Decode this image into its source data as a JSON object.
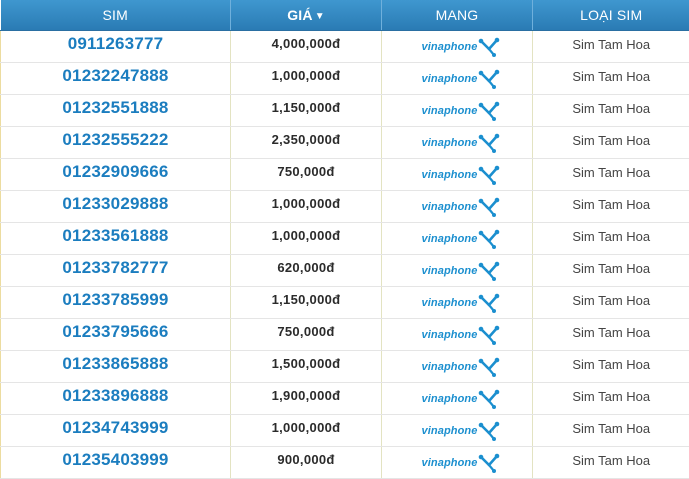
{
  "table": {
    "headers": {
      "sim": "SIM",
      "price": "GIÁ",
      "carrier": "MANG",
      "type": "LOẠI SIM"
    },
    "rows": [
      {
        "number": "0911263777",
        "price": "4,000,000đ",
        "carrier": "vinaphone",
        "type": "Sim Tam Hoa"
      },
      {
        "number": "01232247888",
        "price": "1,000,000đ",
        "carrier": "vinaphone",
        "type": "Sim Tam Hoa"
      },
      {
        "number": "01232551888",
        "price": "1,150,000đ",
        "carrier": "vinaphone",
        "type": "Sim Tam Hoa"
      },
      {
        "number": "01232555222",
        "price": "2,350,000đ",
        "carrier": "vinaphone",
        "type": "Sim Tam Hoa"
      },
      {
        "number": "01232909666",
        "price": "750,000đ",
        "carrier": "vinaphone",
        "type": "Sim Tam Hoa"
      },
      {
        "number": "01233029888",
        "price": "1,000,000đ",
        "carrier": "vinaphone",
        "type": "Sim Tam Hoa"
      },
      {
        "number": "01233561888",
        "price": "1,000,000đ",
        "carrier": "vinaphone",
        "type": "Sim Tam Hoa"
      },
      {
        "number": "01233782777",
        "price": "620,000đ",
        "carrier": "vinaphone",
        "type": "Sim Tam Hoa"
      },
      {
        "number": "01233785999",
        "price": "1,150,000đ",
        "carrier": "vinaphone",
        "type": "Sim Tam Hoa"
      },
      {
        "number": "01233795666",
        "price": "750,000đ",
        "carrier": "vinaphone",
        "type": "Sim Tam Hoa"
      },
      {
        "number": "01233865888",
        "price": "1,500,000đ",
        "carrier": "vinaphone",
        "type": "Sim Tam Hoa"
      },
      {
        "number": "01233896888",
        "price": "1,900,000đ",
        "carrier": "vinaphone",
        "type": "Sim Tam Hoa"
      },
      {
        "number": "01234743999",
        "price": "1,000,000đ",
        "carrier": "vinaphone",
        "type": "Sim Tam Hoa"
      },
      {
        "number": "01235403999",
        "price": "900,000đ",
        "carrier": "vinaphone",
        "type": "Sim Tam Hoa"
      }
    ]
  },
  "colors": {
    "header_bg": "#2f86c1",
    "link": "#1b7dbf",
    "carrier_brand": "#1b8fcf"
  },
  "icons": {
    "sort": "chevron-down-icon",
    "carrier_logo": "vinaphone-logo-icon"
  }
}
